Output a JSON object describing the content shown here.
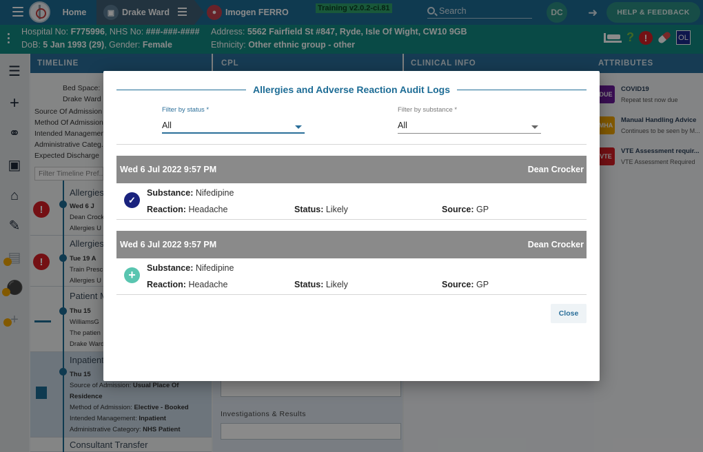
{
  "topbar": {
    "home_label": "Home",
    "ward_label": "Drake Ward",
    "patient_label": "Imogen FERRO",
    "training_label": "Training v2.0.2-ci.81",
    "search_placeholder": "Search",
    "user_initials": "DC",
    "help_label": "HELP & FEEDBACK"
  },
  "banner": {
    "hospital_no_label": "Hospital No: ",
    "hospital_no": "F775996",
    "nhs_no_label": ", NHS No: ",
    "nhs_no": "###-###-####",
    "dob_label": "DoB: ",
    "dob": "5 Jan 1993 (29)",
    "gender_label": ", Gender: ",
    "gender": "Female",
    "address_label": "Address: ",
    "address": "5562 Fairfield St #847, Ryde, Isle Of Wight, CW10 9GB",
    "ethnicity_label": "Ethnicity: ",
    "ethnicity": "Other ethnic group - other",
    "alert_symbol": "!",
    "help_symbol": "?",
    "ol_badge": "OL"
  },
  "panels": {
    "timeline": "TIMELINE",
    "cpl": "CPL",
    "clinical_info": "CLINICAL INFO",
    "attributes": "ATTRIBUTES"
  },
  "timeline": {
    "bed_space": "Bed Space:",
    "ward": "Drake Ward",
    "source": "Source Of Admission",
    "method": "Method Of Admission",
    "intended": "Intended Management",
    "admin_cat": "Administrative Categ...",
    "discharge": "Expected Discharge",
    "filter_placeholder": "Filter Timeline Pref...",
    "rows": [
      {
        "title": "Allergies",
        "date": "Wed 6 J",
        "l1": "Dean Crock",
        "l2": "Allergies U"
      },
      {
        "title": "Allergies",
        "date": "Tue 19 A",
        "l1": "Train Presc",
        "l2": "Allergies U"
      },
      {
        "title": "Patient M",
        "date": "Thu 15 ",
        "l1": "WilliamsG",
        "l2": "The patien",
        "l3": "Drake Ward"
      },
      {
        "title": "Inpatient",
        "date": "Thu 15 ",
        "src_label": "Source of Admission: ",
        "src": "Usual Place Of",
        "src2": "Residence",
        "meth_label": "Method of Admission: ",
        "meth": "Elective - Booked",
        "int_label": "Intended Management: ",
        "int": "Inpatient",
        "adm_label": "Administrative Category: ",
        "adm": "NHS Patient"
      },
      {
        "title": "Consultant Transfer"
      }
    ]
  },
  "cpl": {
    "investigations_label": "Investigations & Results"
  },
  "attributes": [
    {
      "badge": "DUE",
      "badge_color": "#6a1b9a",
      "title": "COVID19",
      "sub": "Repeat test now due"
    },
    {
      "badge": "MHA",
      "badge_color": "#f0a500",
      "title": "Manual Handling Advice",
      "sub": "Continues to be seen by M..."
    },
    {
      "badge": "VTE",
      "badge_color": "#d61f26",
      "title": "VTE Assessment requir...",
      "sub": "VTE Assessment Required"
    }
  ],
  "modal": {
    "title": "Allergies and Adverse Reaction Audit Logs",
    "filter_status_label": "Filter by status *",
    "filter_status_value": "All",
    "filter_substance_label": "Filter by substance *",
    "filter_substance_value": "All",
    "close_label": "Close",
    "logs": [
      {
        "datetime": "Wed 6 Jul 2022 9:57 PM",
        "user": "Dean Crocker",
        "icon": "check-circle-icon",
        "substance_label": "Substance:",
        "substance": "Nifedipine",
        "reaction_label": "Reaction:",
        "reaction": "Headache",
        "status_label": "Status:",
        "status": "Likely",
        "source_label": "Source:",
        "source": "GP"
      },
      {
        "datetime": "Wed 6 Jul 2022 9:57 PM",
        "user": "Dean Crocker",
        "icon": "plus-circle-icon",
        "substance_label": "Substance:",
        "substance": "Nifedipine",
        "reaction_label": "Reaction:",
        "reaction": "Headache",
        "status_label": "Status:",
        "status": "Likely",
        "source_label": "Source:",
        "source": "GP"
      }
    ]
  },
  "colors": {
    "topbar": "#1d6c95",
    "banner": "#128a82",
    "accent": "#2a6e99",
    "log_header": "#8a8a8a",
    "check_icon": "#1a237e",
    "plus_icon": "#59c5b0"
  }
}
